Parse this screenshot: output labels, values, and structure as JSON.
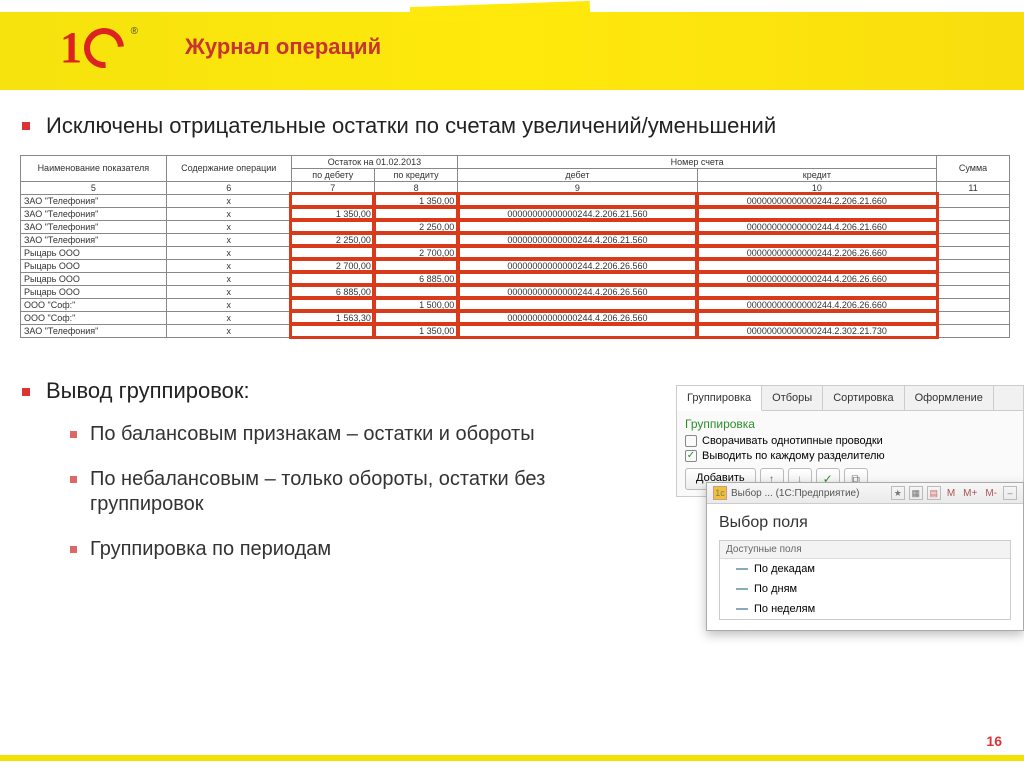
{
  "title": "Журнал операций",
  "bullet_main": "Исключены отрицательные остатки по счетам увеличений/уменьшений",
  "table": {
    "group_hdr": {
      "name": "Наименование показателя",
      "op": "Содержание операции",
      "bal": "Остаток на 01.02.2013",
      "acct": "Номер счета",
      "sum": "Сумма"
    },
    "sub_hdr": {
      "deb": "по дебету",
      "cred": "по кредиту",
      "debit": "дебет",
      "credit": "кредит"
    },
    "nums": {
      "c1": "5",
      "c2": "6",
      "c3": "7",
      "c4": "8",
      "c5": "9",
      "c6": "10",
      "c7": "11"
    },
    "rows": [
      {
        "name": "ЗАО \"Телефония\"",
        "op": "x",
        "deb": "",
        "cred": "1 350,00",
        "debit": "",
        "credit": "00000000000000244.2.206.21.660",
        "sum": ""
      },
      {
        "name": "ЗАО \"Телефония\"",
        "op": "x",
        "deb": "1 350,00",
        "cred": "",
        "debit": "00000000000000244.2.206.21.560",
        "credit": "",
        "sum": ""
      },
      {
        "name": "ЗАО \"Телефония\"",
        "op": "x",
        "deb": "",
        "cred": "2 250,00",
        "debit": "",
        "credit": "00000000000000244.4.206.21.660",
        "sum": ""
      },
      {
        "name": "ЗАО \"Телефония\"",
        "op": "x",
        "deb": "2 250,00",
        "cred": "",
        "debit": "00000000000000244.4.206.21.560",
        "credit": "",
        "sum": ""
      },
      {
        "name": "Рыцарь ООО",
        "op": "x",
        "deb": "",
        "cred": "2 700,00",
        "debit": "",
        "credit": "00000000000000244.2.206.26.660",
        "sum": ""
      },
      {
        "name": "Рыцарь ООО",
        "op": "x",
        "deb": "2 700,00",
        "cred": "",
        "debit": "00000000000000244.2.206.26.560",
        "credit": "",
        "sum": ""
      },
      {
        "name": "Рыцарь ООО",
        "op": "x",
        "deb": "",
        "cred": "6 885,00",
        "debit": "",
        "credit": "00000000000000244.4.206.26.660",
        "sum": ""
      },
      {
        "name": "Рыцарь ООО",
        "op": "x",
        "deb": "6 885,00",
        "cred": "",
        "debit": "00000000000000244.4.206.26.560",
        "credit": "",
        "sum": ""
      },
      {
        "name": "ООО \"Соф:\"",
        "op": "x",
        "deb": "",
        "cred": "1 500,00",
        "debit": "",
        "credit": "00000000000000244.4.206.26.660",
        "sum": ""
      },
      {
        "name": "ООО \"Соф:\"",
        "op": "x",
        "deb": "1 563,30",
        "cred": "",
        "debit": "00000000000000244.4.206.26.560",
        "credit": "",
        "sum": ""
      },
      {
        "name": "ЗАО \"Телефония\"",
        "op": "x",
        "deb": "",
        "cred": "1 350,00",
        "debit": "",
        "credit": "00000000000000244.2.302.21.730",
        "sum": ""
      }
    ]
  },
  "section2_title": "Вывод группировок:",
  "sub_items": [
    "По балансовым признакам – остатки и обороты",
    "По небалансовым – только обороты, остатки без группировок",
    "Группировка по периодам"
  ],
  "panel": {
    "tabs": [
      "Группировка",
      "Отборы",
      "Сортировка",
      "Оформление"
    ],
    "grp_label": "Группировка",
    "chk1": "Сворачивать однотипные проводки",
    "chk2": "Выводить по каждому разделителю",
    "add_btn": "Добавить"
  },
  "modal": {
    "bar": "Выбор ... (1С:Предприятие)",
    "title": "Выбор поля",
    "fields_hdr": "Доступные поля",
    "fields": [
      "По декадам",
      "По дням",
      "По неделям"
    ],
    "m_marks": [
      "M",
      "M+",
      "M-"
    ]
  },
  "page_number": "16"
}
